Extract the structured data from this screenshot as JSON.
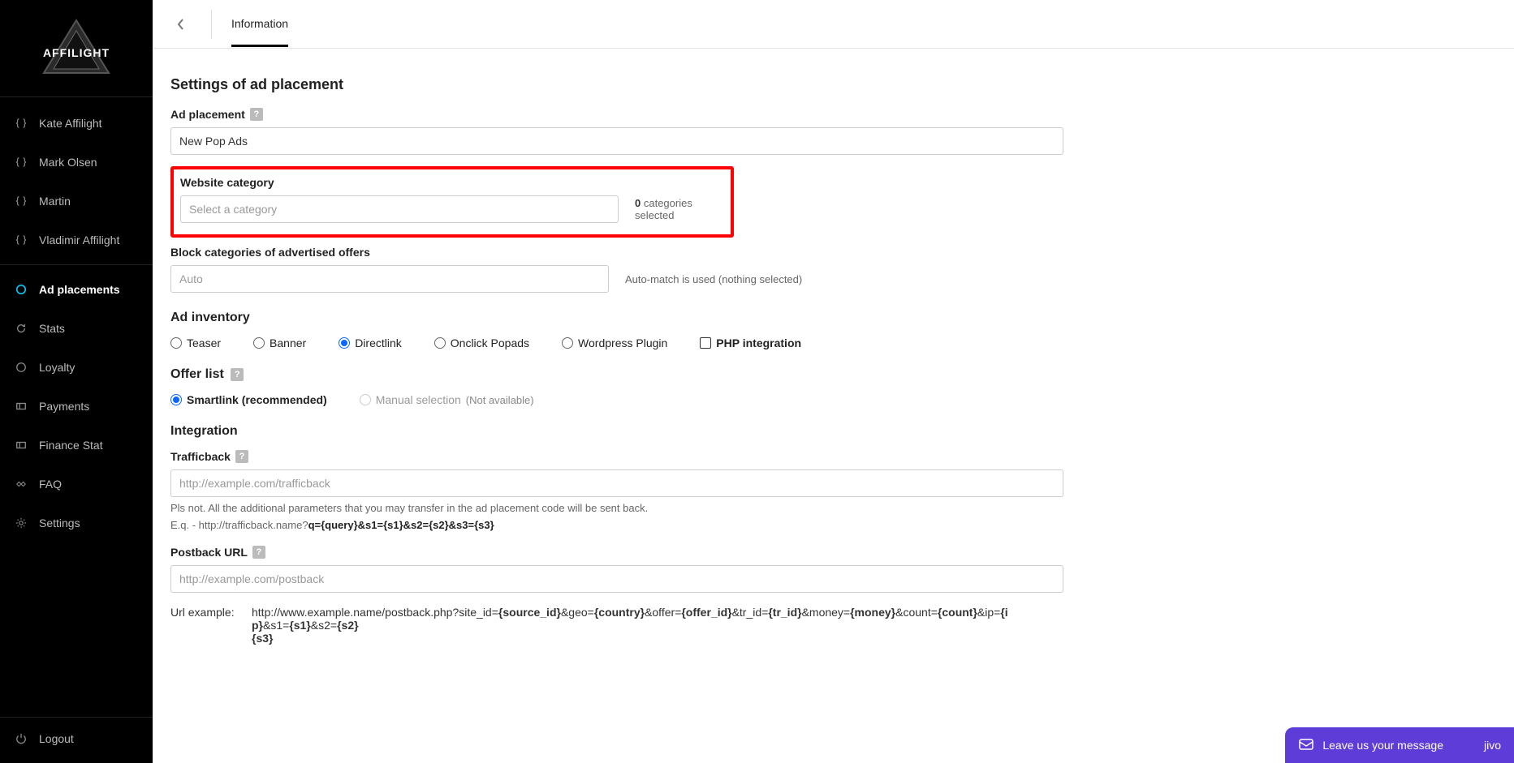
{
  "app": {
    "logo_text": "AFFILIGHT"
  },
  "sidebar": {
    "users": [
      "Kate Affilight",
      "Mark Olsen",
      "Martin",
      "Vladimir Affilight"
    ],
    "nav": {
      "ad_placements": "Ad placements",
      "stats": "Stats",
      "loyalty": "Loyalty",
      "payments": "Payments",
      "finance_stat": "Finance Stat",
      "faq": "FAQ",
      "settings": "Settings",
      "logout": "Logout"
    }
  },
  "tabs": {
    "information": "Information"
  },
  "sections": {
    "settings_title": "Settings of ad placement",
    "ad_placement_label": "Ad placement",
    "ad_placement_value": "New Pop Ads",
    "website_category_label": "Website category",
    "website_category_placeholder": "Select a category",
    "website_category_status_count": "0",
    "website_category_status_text": " categories selected",
    "block_categories_label": "Block categories of advertised offers",
    "block_categories_placeholder": "Auto",
    "block_categories_status": "Auto-match is used (nothing selected)",
    "ad_inventory_title": "Ad inventory",
    "ad_inventory": {
      "teaser": "Teaser",
      "banner": "Banner",
      "directlink": "Directlink",
      "onclick": "Onclick Popads",
      "wordpress": "Wordpress Plugin",
      "php": "PHP integration"
    },
    "offer_list_title": "Offer list",
    "offer_list": {
      "smartlink": "Smartlink (recommended)",
      "manual": "Manual selection",
      "manual_na": "(Not available)"
    },
    "integration_title": "Integration",
    "trafficback_label": "Trafficback",
    "trafficback_placeholder": "http://example.com/trafficback",
    "trafficback_hint1": "Pls not. All the additional parameters that you may transfer in the ad placement code will be sent back.",
    "trafficback_hint2_prefix": "E.q. - http://trafficback.name?",
    "trafficback_hint2_bold": "q={query}&s1={s1}&s2={s2}&s3={s3}",
    "postback_label": "Postback URL",
    "postback_placeholder": "http://example.com/postback",
    "url_example_label": "Url example:",
    "url_example_prefix": "http://www.example.name/postback.php?site_id=",
    "url_example_bold1": "{source_id}",
    "url_example_mid1": "&geo=",
    "url_example_bold2": "{country}",
    "url_example_mid2": "&offer=",
    "url_example_bold3": "{offer_id}",
    "url_example_mid3": "&tr_id=",
    "url_example_bold4": "{tr_id}",
    "url_example_mid4": "&money=",
    "url_example_bold5": "{money}",
    "url_example_mid5": "&count=",
    "url_example_bold6": "{count}",
    "url_example_mid6": "&ip=",
    "url_example_bold7": "{ip}",
    "url_example_mid7": "&s1=",
    "url_example_bold8": "{s1}",
    "url_example_mid8": "&s2=",
    "url_example_bold9": "{s2}",
    "url_example_bold10": "{s3}"
  },
  "chat": {
    "label": "Leave us your message",
    "brand": "jivo"
  }
}
